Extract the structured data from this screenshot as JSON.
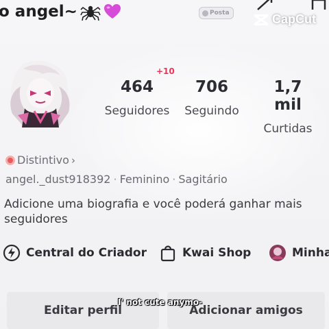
{
  "profile": {
    "display_name": "o angel~",
    "post_badge": "Posta",
    "plus_badge": "+10",
    "stats": [
      {
        "value": "464",
        "label": "Seguidores"
      },
      {
        "value": "706",
        "label": "Seguindo"
      },
      {
        "value": "1,7 mil",
        "label": "Curtidas"
      }
    ],
    "distintivo_label": "Distintivo",
    "username": "angel._dust918392",
    "gender": "Feminino",
    "sign": "Sagitário",
    "bio": "Adicione uma biografia e você poderá ganhar mais seguidores"
  },
  "shortcuts": [
    {
      "label": "Central do Criador",
      "icon": "lightning-circle-icon"
    },
    {
      "label": "Kwai Shop",
      "icon": "shopping-bag-icon"
    },
    {
      "label": "Minha",
      "icon": "avatar-icon"
    }
  ],
  "buttons": {
    "edit_profile": "Editar perfil",
    "add_friends": "Adicionar amigos"
  },
  "watermark": {
    "text": "CapCut"
  },
  "caption": {
    "text": "I' not cute anymo-"
  },
  "colors": {
    "accent": "#e8375b",
    "heart": "#d64bd8",
    "badge_medal": "#e95a5a"
  }
}
